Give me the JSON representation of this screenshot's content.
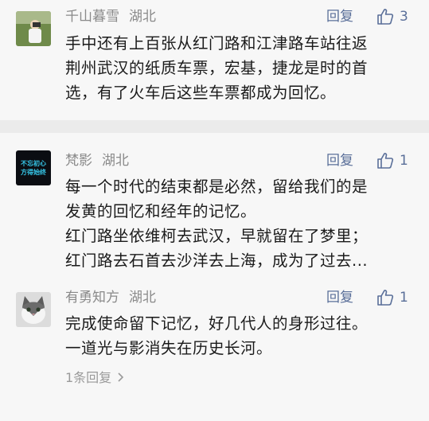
{
  "comments": [
    {
      "author": "千山暮雪",
      "location": "湖北",
      "reply_label": "回复",
      "likes": "3",
      "lines": [
        "手中还有上百张从红门路和江津路车站往返",
        "荆州武汉的纸质车票，宏基，捷龙是时的首",
        "选，有了火车后这些车票都成为回忆。"
      ]
    },
    {
      "author": "梵影",
      "location": "湖北",
      "reply_label": "回复",
      "likes": "1",
      "avatar_text": [
        "不忘初心",
        "方得始终"
      ],
      "lines": [
        "每一个时代的结束都是必然，留给我们的是",
        "发黄的回忆和经年的记忆。",
        "红门路坐依维柯去武汉，早就留在了梦里；",
        "红门路去石首去沙洋去上海，成为了过去..."
      ]
    },
    {
      "author": "有勇知方",
      "location": "湖北",
      "reply_label": "回复",
      "likes": "1",
      "lines": [
        "完成使命留下记忆，好几代人的身形过往。",
        "一道光与影消失在历史长河。"
      ],
      "more_replies": "1条回复"
    }
  ],
  "icons": {
    "like": "thumbs-up-icon",
    "more": "chevron-right-icon"
  },
  "colors": {
    "accent": "#5a6f99",
    "meta": "#8a8a8a",
    "text": "#1a1a1a"
  }
}
